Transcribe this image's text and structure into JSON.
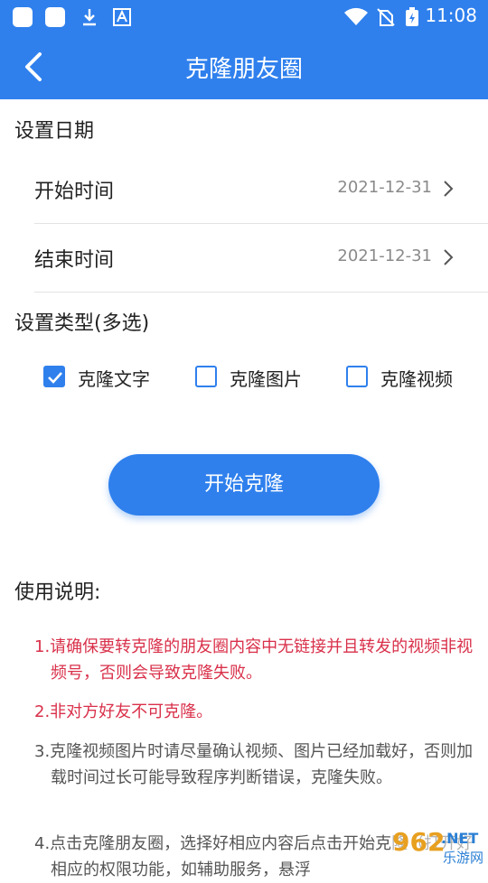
{
  "status_bar": {
    "time": "11:08",
    "icons": [
      "app-square-icon",
      "app-square-icon",
      "download-icon",
      "font-a-icon",
      "wifi-icon",
      "no-sim-icon",
      "battery-charging-icon"
    ]
  },
  "app_bar": {
    "title": "克隆朋友圈"
  },
  "date_section": {
    "title": "设置日期",
    "start": {
      "label": "开始时间",
      "value": "2021-12-31"
    },
    "end": {
      "label": "结束时间",
      "value": "2021-12-31"
    }
  },
  "type_section": {
    "title": "设置类型(多选)",
    "options": [
      {
        "label": "克隆文字",
        "checked": true
      },
      {
        "label": "克隆图片",
        "checked": false
      },
      {
        "label": "克隆视频",
        "checked": false
      }
    ]
  },
  "start_button": "开始克隆",
  "instructions": {
    "title": "使用说明:",
    "items": [
      "1.请确保要转克隆的朋友圈内容中无链接并且转发的视频非视频号，否则会导致克隆失败。",
      "2.非对方好友不可克隆。",
      "3.克隆视频图片时请尽量确认视频、图片已经加载好，否则加载时间过长可能导致程序判断错误，克隆失败。",
      "4.点击克隆朋友圈，选择好相应内容后点击开始克隆（打开好相应的权限功能，如辅助服务，悬浮"
    ]
  },
  "watermark": {
    "number": "962",
    "suffix": ".NET",
    "text": "乐游网"
  },
  "colors": {
    "primary": "#2f80ed",
    "warning_text": "#d9304a",
    "body_text": "#555555",
    "muted_text": "#8a8a8a"
  }
}
